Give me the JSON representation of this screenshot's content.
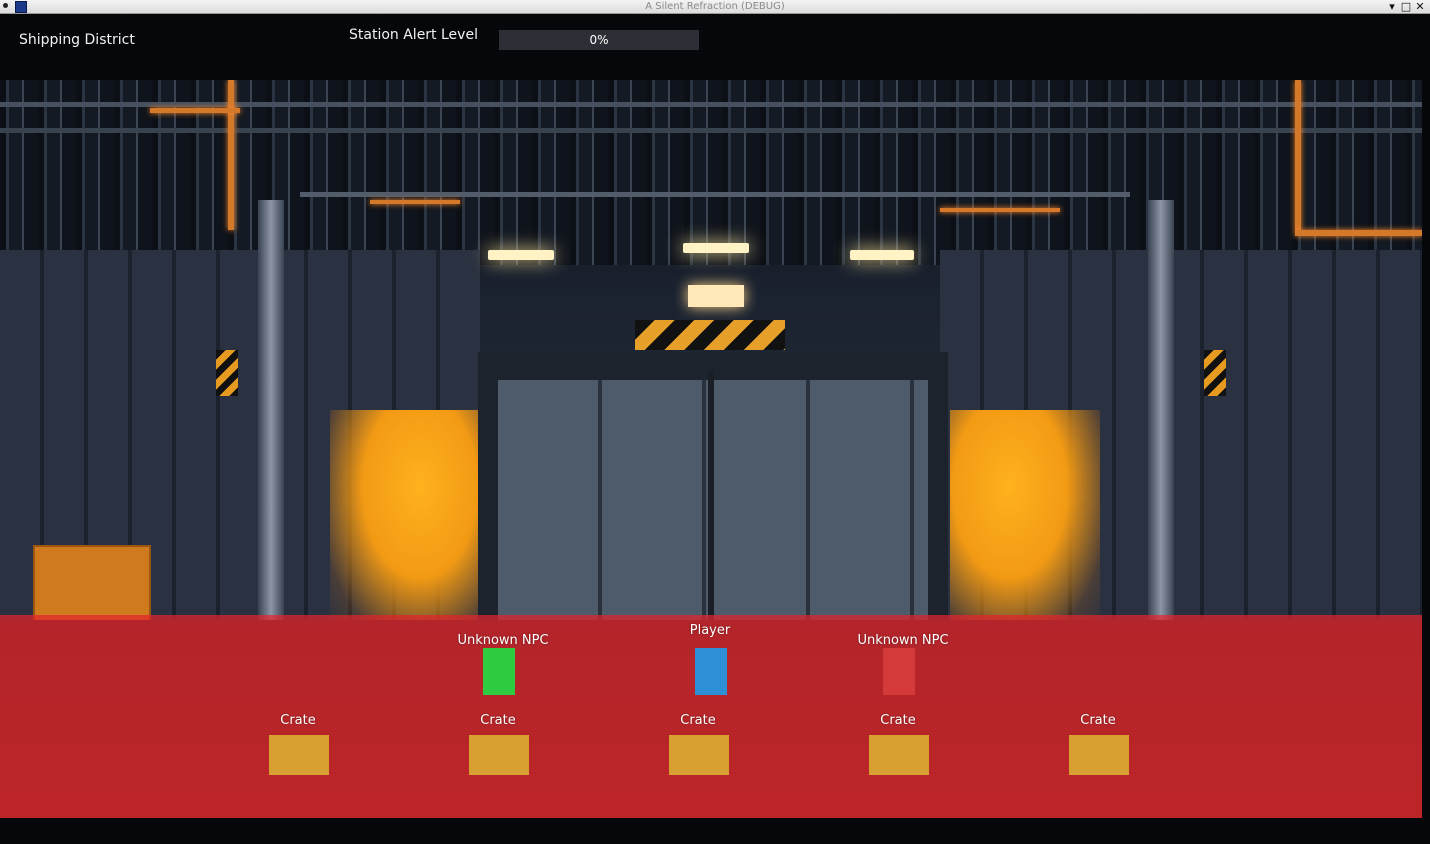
{
  "window": {
    "title": "A Silent Refraction (DEBUG)",
    "controls": [
      "minimize",
      "maximize",
      "close"
    ]
  },
  "hud": {
    "location": "Shipping District",
    "alert_label": "Station Alert Level",
    "alert_value_text": "0%",
    "alert_fraction": 0
  },
  "scene": {
    "entities": {
      "npc_1": {
        "label": "Unknown NPC",
        "color": "#2ecc40"
      },
      "player": {
        "label": "Player",
        "color": "#2f8fd6"
      },
      "npc_2": {
        "label": "Unknown NPC",
        "color": "#d43a3a"
      },
      "crate_1": {
        "label": "Crate",
        "color": "#d8a030"
      },
      "crate_2": {
        "label": "Crate",
        "color": "#d8a030"
      },
      "crate_3": {
        "label": "Crate",
        "color": "#d8a030"
      },
      "crate_4": {
        "label": "Crate",
        "color": "#d8a030"
      },
      "crate_5": {
        "label": "Crate",
        "color": "#d8a030"
      }
    },
    "danger_zone_color": "#e2242c"
  }
}
